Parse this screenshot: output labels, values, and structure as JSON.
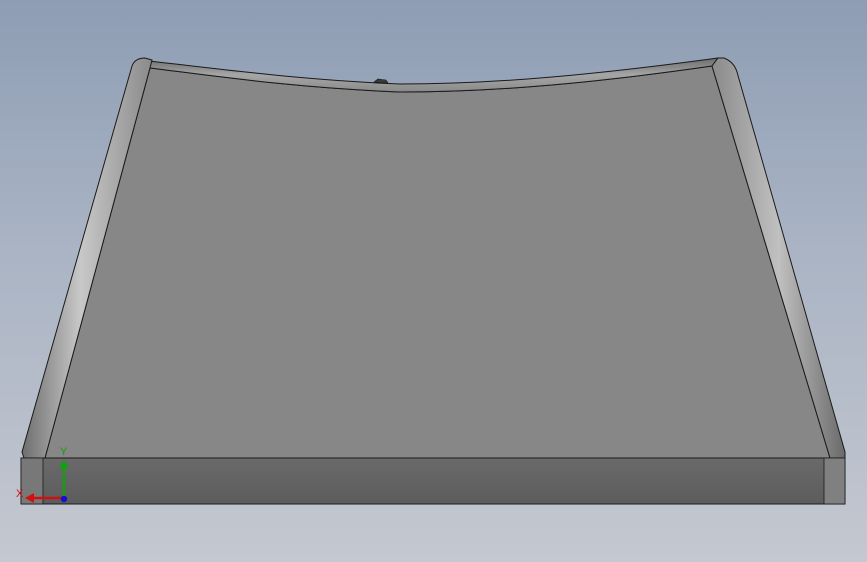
{
  "viewport": {
    "background_top": "#8e9db4",
    "background_bottom": "#c4c8d0"
  },
  "model": {
    "top_face_color": "#878787",
    "front_face_color": "#626262",
    "edge_color": "#1a1a1a",
    "fillet_light": "#b8b8b8",
    "fillet_dark": "#6a6a6a"
  },
  "triad": {
    "x_label": "X",
    "y_label": "Y",
    "x_color": "#d01010",
    "y_color": "#10a010",
    "z_color": "#1010d0"
  }
}
